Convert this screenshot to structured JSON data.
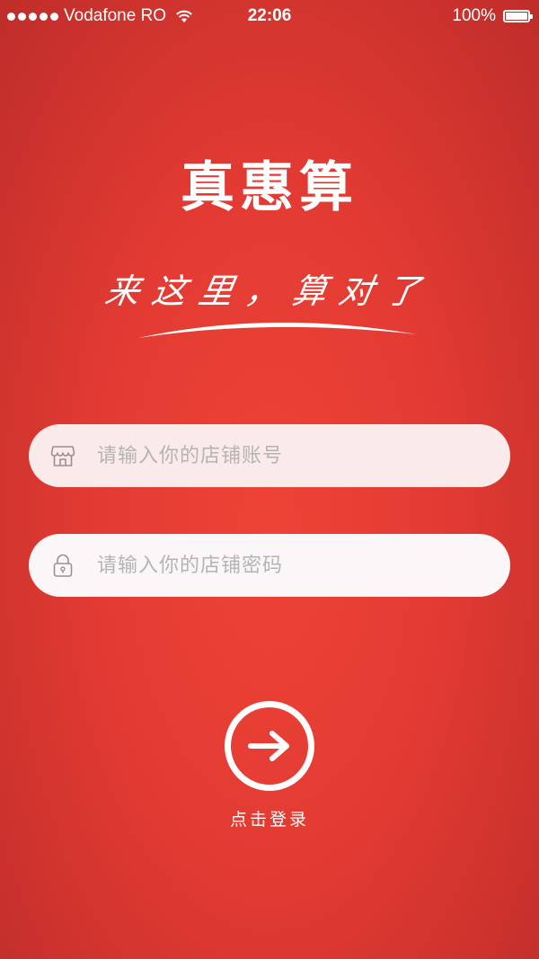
{
  "status_bar": {
    "carrier": "Vodafone RO",
    "time": "22:06",
    "battery": "100%",
    "battery_level": 1.0
  },
  "app": {
    "title": "真惠算",
    "slogan": "来这里，算对了"
  },
  "login_form": {
    "account_placeholder": "请输入你的店铺账号",
    "password_placeholder": "请输入你的店铺密码",
    "account_icon": "store-icon",
    "password_icon": "lock-icon"
  },
  "login_button": {
    "label": "点击登录",
    "icon": "arrow-right-icon"
  },
  "colors": {
    "background": "#e53e34",
    "account_field_bg": "#fbeaea",
    "password_field_bg": "#fbf7f8",
    "placeholder_text": "#b6b3b3"
  }
}
